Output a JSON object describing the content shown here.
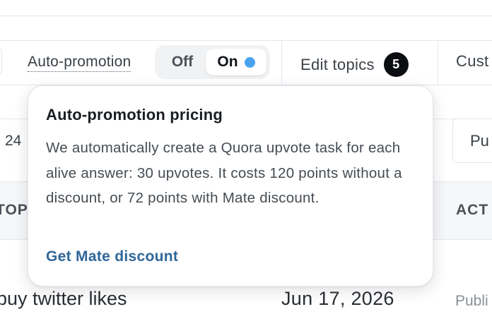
{
  "toolbar": {
    "autopromo_label": "Auto-promotion",
    "toggle": {
      "off_label": "Off",
      "on_label": "On",
      "selected": "On",
      "indicator_color": "#4aa3ee"
    },
    "edit_topics_label": "Edit topics",
    "edit_topics_count": "5",
    "cust_label": "Cust"
  },
  "popover": {
    "title": "Auto-promotion pricing",
    "body": "We automatically create a Quora upvote task for each alive answer: 30 upvotes. It costs 120 points without a discount, or 72 points with Mate discount.",
    "link_label": "Get Mate discount",
    "link_color": "#2f6699"
  },
  "background": {
    "count_fragment": "24",
    "pu_fragment": "Pu",
    "table": {
      "header_left": "TOP",
      "header_right": "ACT",
      "row": {
        "keyword": "buy twitter likes",
        "date": "Jun 17, 2026",
        "status": "Publi"
      }
    }
  }
}
